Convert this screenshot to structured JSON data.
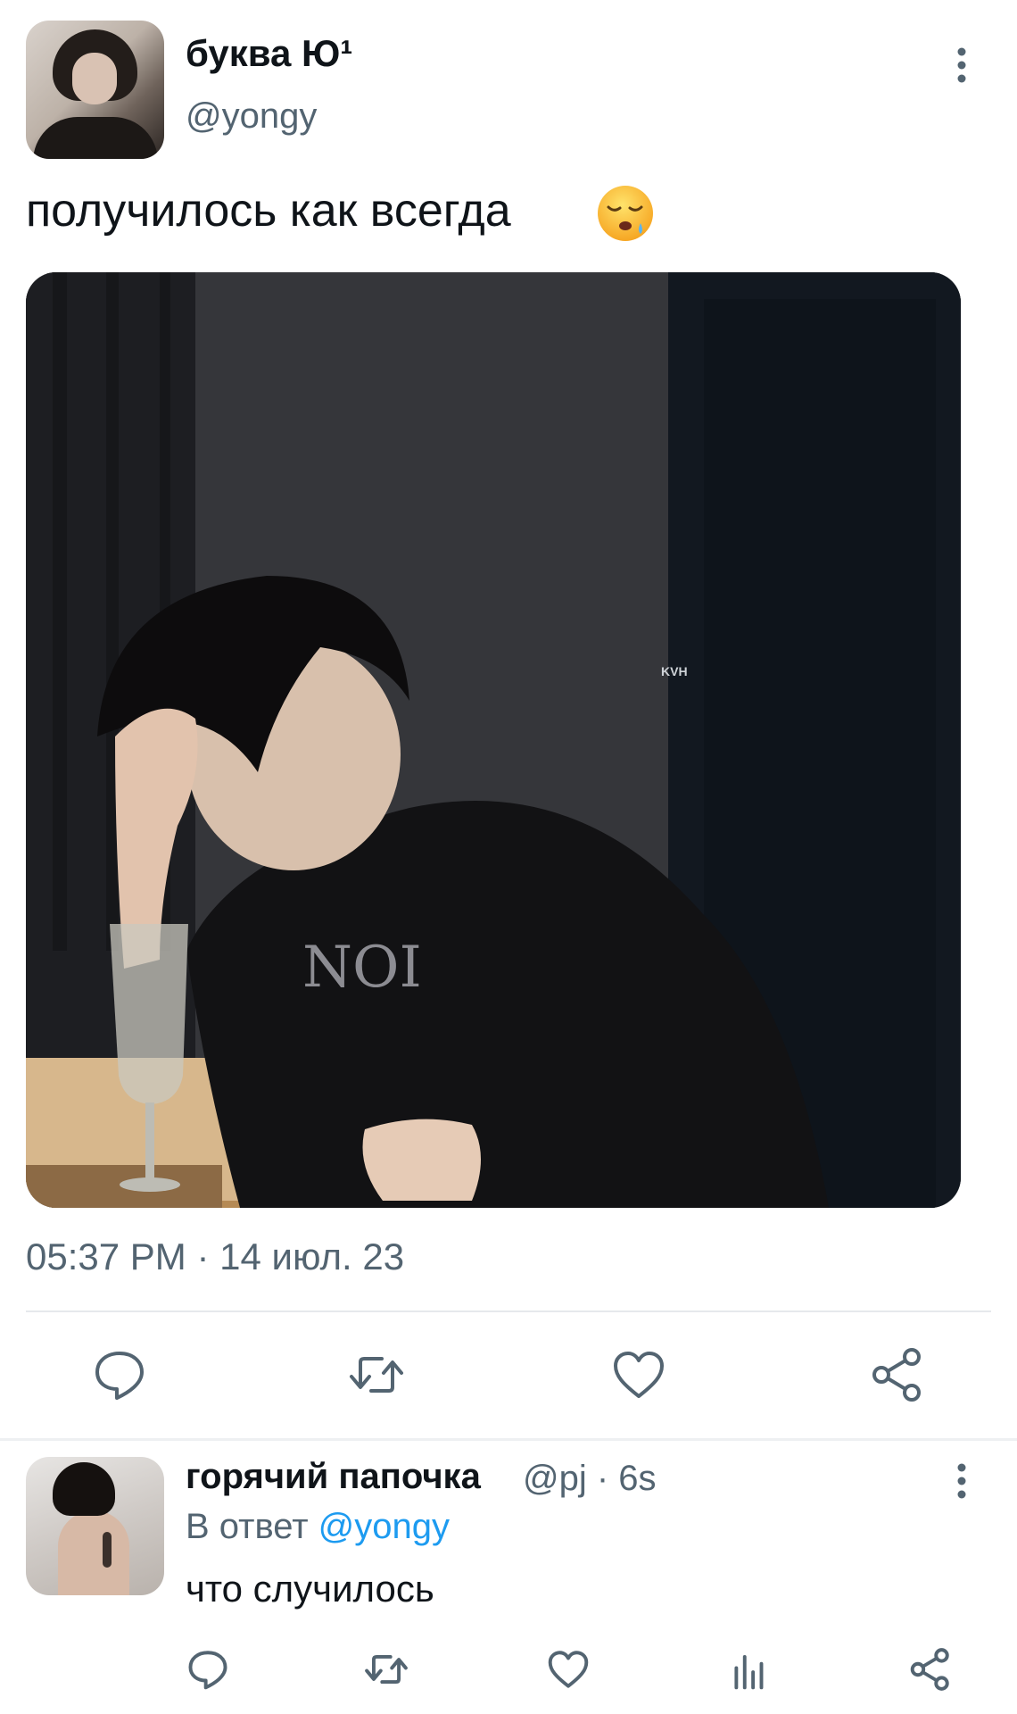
{
  "tweet": {
    "author": {
      "display_name": "буква Ю¹",
      "handle": "@yongy",
      "avatar_icon": "profile-photo"
    },
    "text": "получилось как всегда",
    "emoji": "sleepy-face",
    "media": {
      "watermark": "KVH",
      "shirt_text": "NOI"
    },
    "timestamp": "05:37 PM · 14 июл. 23",
    "actions": [
      "reply-icon",
      "retweet-icon",
      "like-icon",
      "share-icon"
    ]
  },
  "reply": {
    "author": {
      "display_name": "горячий папочка",
      "meta": "@pj · 6s"
    },
    "reply_prefix": "В ответ",
    "reply_to": "@yongy",
    "text": "что случилось",
    "actions": [
      "reply-icon",
      "retweet-icon",
      "like-icon",
      "analytics-icon",
      "share-icon"
    ]
  },
  "colors": {
    "text_primary": "#0f1419",
    "text_secondary": "#536471",
    "accent": "#1d9bf0",
    "divider": "#e6e9ec"
  }
}
